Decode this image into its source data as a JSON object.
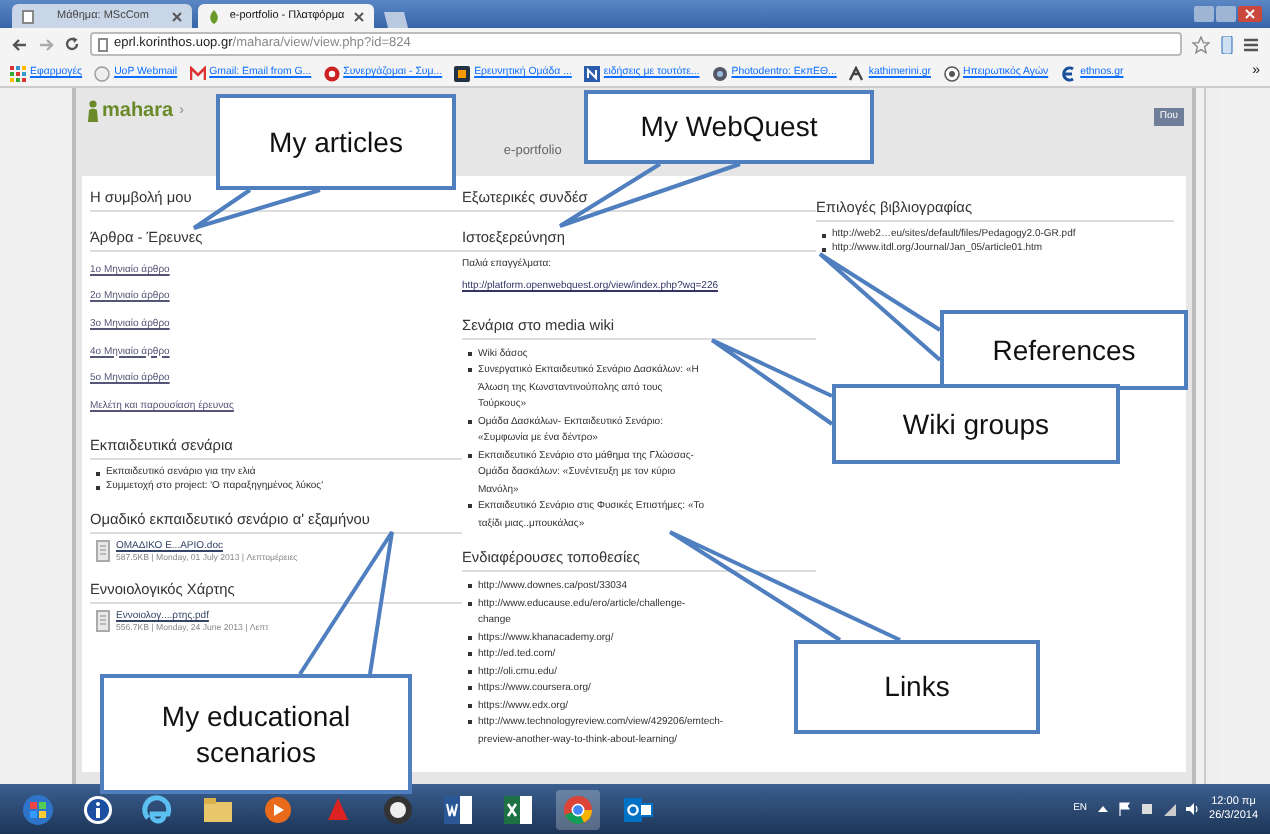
{
  "browser": {
    "tabs": [
      {
        "label": "Μάθημα: MScCom",
        "selected": false
      },
      {
        "label": "e-portfolio - Πλατφόρμα",
        "selected": true
      }
    ],
    "address": {
      "host": "eprl.korinthos.uop.gr",
      "path": "/mahara/view/view.php?id=824"
    },
    "bookmarks": [
      "Εφαρμογές",
      "UoP Webmail",
      "Gmail: Email from G...",
      "Συνεργάζομαι - Συμ...",
      "Ερευνητική Ομάδα ...",
      "ειδήσεις με τουτότε...",
      "Photodentro: ΕκπΕΘ...",
      "kathimerini.gr",
      "Ηπειρωτικός Αγών",
      "ethnos.gr"
    ],
    "more": "»"
  },
  "page": {
    "logo": "mahara",
    "crumb": "›",
    "subtitle": "e-portfolio",
    "button": "Που",
    "columns": [
      [
        {
          "title": "Η συμβολή μου",
          "kind": "page-title"
        },
        {
          "title": "Άρθρα - Έρευνες",
          "items": [
            {
              "kind": "plain",
              "text": "1ο Μηνιαίο άρθρο"
            },
            {
              "kind": "plain",
              "text": "2ο Μηνιαίο άρθρο"
            },
            {
              "kind": "plain",
              "text": "3ο Μηνιαίο άρθρο"
            },
            {
              "kind": "plain",
              "text": "4ο Μηνιαίο άρθρο"
            },
            {
              "kind": "plain",
              "text": "5ο Μηνιαίο άρθρο"
            },
            {
              "kind": "plain",
              "text": "Μελέτη και παρουσίαση έρευνας"
            }
          ]
        },
        {
          "title": "Εκπαιδευτικά σενάρια",
          "items": [
            {
              "kind": "bullet",
              "text": "Εκπαιδευτικό σενάριο για την ελιά"
            },
            {
              "kind": "bullet",
              "text": "Συμμετοχή στο project: 'Ο παραξηγημένος λύκος'"
            }
          ]
        },
        {
          "title": "Ομαδικό εκπαιδευτικό σενάριο α' εξαμήνου",
          "items": [
            {
              "kind": "file",
              "text": "ΟΜΑΔΙΚΟ Ε...ΑΡΙΟ.doc",
              "meta": "587.5KB | Monday, 01 July 2013 | Λεπτομέρειες"
            }
          ]
        },
        {
          "title": "Εννοιολογικός Χάρτης",
          "items": [
            {
              "kind": "file",
              "text": "Εννοιολογ....ρτης.pdf",
              "meta": "556.7KB | Monday, 24 June 2013 | Λεπτ"
            }
          ]
        }
      ],
      [
        {
          "title": "Εξωτερικές συνδέσ",
          "kind": "page-title"
        },
        {
          "title": "Ιστοεξερεύνηση",
          "items": [
            {
              "kind": "text",
              "text": "Παλιά επαγγέλματα:"
            },
            {
              "kind": "url",
              "text": "http://platform.openwebquest.org/view/index.php?wq=226"
            }
          ]
        },
        {
          "title": "Σενάρια στο media wiki",
          "items": [
            {
              "kind": "bullet",
              "text": "Wiki δάσος"
            },
            {
              "kind": "bullet",
              "text": "Συνεργατικό Εκπαιδευτικό Σενάριο Δασκάλων: «Η Άλωση της Κωνσταντινούπολης από τους Τούρκους»"
            },
            {
              "kind": "bullet",
              "text": "Ομάδα Δασκάλων- Εκπαιδευτικό Σενάριο: «Συμφωνία με ένα δέντρο»"
            },
            {
              "kind": "bullet",
              "text": "Εκπαιδευτικό Σενάριο στο μάθημα της Γλώσσας- Ομάδα δασκάλων: «Συνέντευξη με τον κύριο Μανόλη»"
            },
            {
              "kind": "bullet",
              "text": "Εκπαιδευτικό Σενάριο στις Φυσικές Επιστήμες: «Το ταξίδι μιας..μπουκάλας»"
            }
          ]
        },
        {
          "title": "Ενδιαφέρουσες τοποθεσίες",
          "items": [
            {
              "kind": "bullet",
              "text": "http://www.downes.ca/post/33034"
            },
            {
              "kind": "bullet",
              "text": "http://www.educause.edu/ero/article/challenge-change"
            },
            {
              "kind": "bullet",
              "text": "https://www.khanacademy.org/"
            },
            {
              "kind": "bullet",
              "text": "http://ed.ted.com/"
            },
            {
              "kind": "bullet",
              "text": "http://oli.cmu.edu/"
            },
            {
              "kind": "bullet",
              "text": "https://www.coursera.org/"
            },
            {
              "kind": "bullet",
              "text": "https://www.edx.org/"
            },
            {
              "kind": "bullet",
              "text": "http://www.technologyreview.com/view/429206/emtech-preview-another-way-to-think-about-learning/"
            }
          ]
        }
      ],
      [
        {
          "title": "Επιλογές βιβλιογραφίας",
          "items": [
            {
              "kind": "bullet",
              "text": "http://web2…eu/sites/default/files/Pedagogy2.0-GR.pdf"
            },
            {
              "kind": "bullet",
              "text": "http://www.itdl.org/Journal/Jan_05/article01.htm"
            }
          ]
        }
      ]
    ]
  },
  "callouts": [
    "My articles",
    "My WebQuest",
    "References",
    "Wiki groups",
    "Links",
    "My educational scenarios"
  ],
  "taskbar": {
    "language": "EN",
    "time": "12:00 πμ",
    "date": "26/3/2014"
  }
}
